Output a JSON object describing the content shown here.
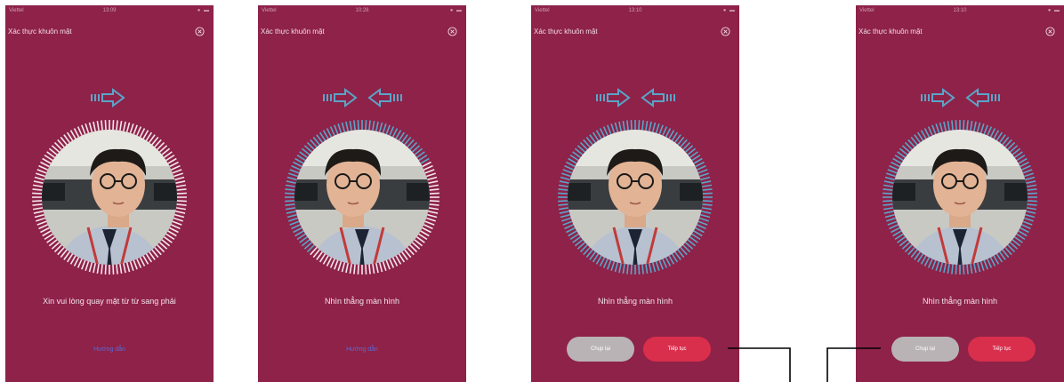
{
  "colors": {
    "background": "#8e2249",
    "accent_blue": "#5aa5c8",
    "button_primary": "#d92e4c",
    "button_secondary": "#b9b3b6",
    "link": "#5b6bd8"
  },
  "screens": [
    {
      "status": {
        "carrier": "Viettel",
        "time": "13:09"
      },
      "title": "Xác thực khuôn mặt",
      "instruction": "Xin vui lòng quay mặt từ từ sang phải",
      "guide_link": "Hướng dẫn",
      "ring_progress": 0.0
    },
    {
      "status": {
        "carrier": "Viettel",
        "time": "10:28"
      },
      "title": "Xác thực khuôn mặt",
      "instruction": "Nhìn thẳng màn hình",
      "guide_link": "Hướng dẫn",
      "ring_progress": 0.55
    },
    {
      "status": {
        "carrier": "Viettel",
        "time": "13:10"
      },
      "title": "Xác thực khuôn mặt",
      "instruction": "Nhìn thẳng màn hình",
      "buttons": {
        "retake": "Chụp lại",
        "continue": "Tiếp tục"
      },
      "ring_progress": 1.0
    },
    {
      "status": {
        "carrier": "Viettel",
        "time": "13:10"
      },
      "title": "Xác thực khuôn mặt",
      "instruction": "Nhìn thẳng màn hình",
      "buttons": {
        "retake": "Chụp lại",
        "continue": "Tiếp tục"
      },
      "ring_progress": 1.0
    }
  ]
}
